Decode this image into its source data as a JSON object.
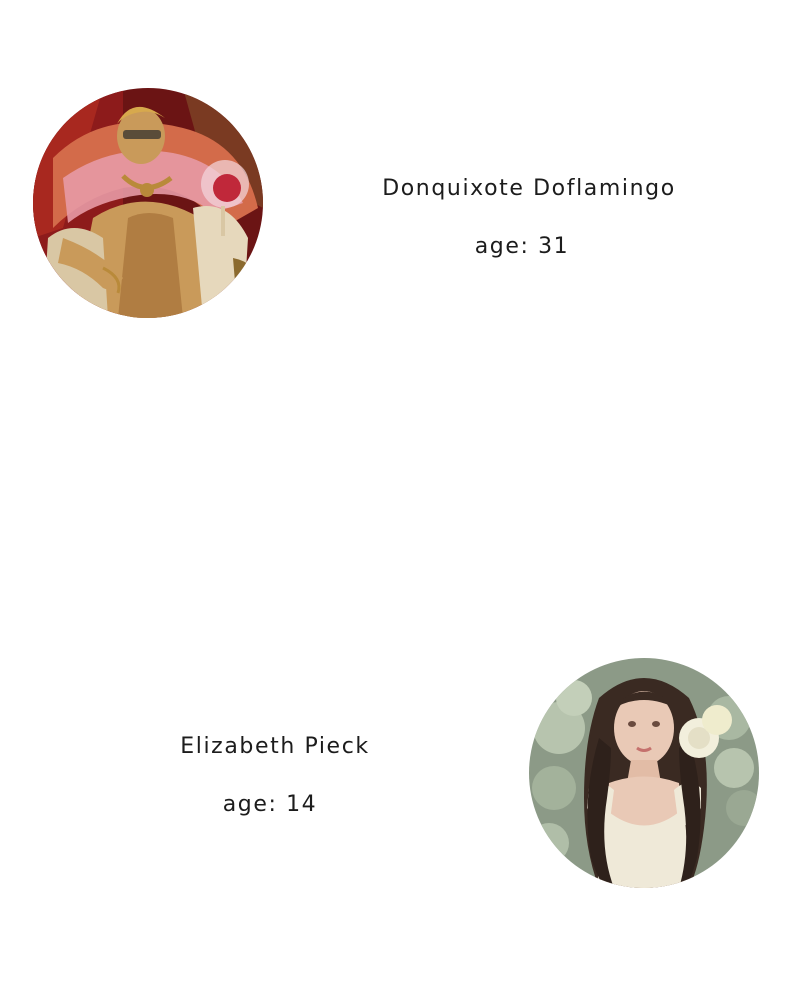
{
  "profiles": [
    {
      "name": "Donquixote Doflamingo",
      "age_text": "age: 31",
      "avatar_icon": "character-portrait-icon",
      "colors": {
        "bg_dark": "#6b1414",
        "bg_mid": "#a8281f",
        "skin": "#c99a5a",
        "gold": "#b98a3a",
        "coat": "#d9c7a4",
        "pink": "#e79aa5"
      }
    },
    {
      "name": "Elizabeth Pieck",
      "age_text": "age: 14",
      "avatar_icon": "character-portrait-icon",
      "colors": {
        "bg": "#8c9a87",
        "roses": "#b7c4ae",
        "hair": "#3a2a22",
        "skin": "#e9c9b6",
        "dress": "#efe9d8",
        "white_rose": "#f2efdc"
      }
    }
  ]
}
